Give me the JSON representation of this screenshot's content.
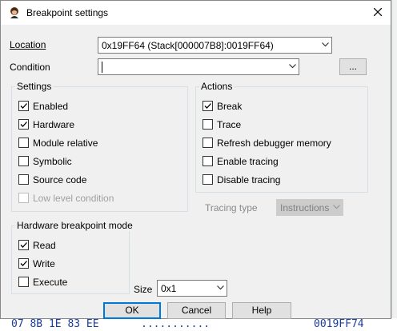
{
  "window": {
    "title": "Breakpoint settings"
  },
  "location": {
    "label": "Location",
    "value": "0x19FF64 (Stack[000007B8]:0019FF64)"
  },
  "condition": {
    "label": "Condition",
    "value": "",
    "browse_label": "..."
  },
  "settings": {
    "title": "Settings",
    "items": [
      {
        "label": "Enabled",
        "checked": true,
        "enabled": true
      },
      {
        "label": "Hardware",
        "checked": true,
        "enabled": true
      },
      {
        "label": "Module relative",
        "checked": false,
        "enabled": true
      },
      {
        "label": "Symbolic",
        "checked": false,
        "enabled": true
      },
      {
        "label": "Source code",
        "checked": false,
        "enabled": true
      },
      {
        "label": "Low level condition",
        "checked": false,
        "enabled": false
      }
    ]
  },
  "actions": {
    "title": "Actions",
    "items": [
      {
        "label": "Break",
        "checked": true,
        "enabled": true
      },
      {
        "label": "Trace",
        "checked": false,
        "enabled": true
      },
      {
        "label": "Refresh debugger memory",
        "checked": false,
        "enabled": true
      },
      {
        "label": "Enable tracing",
        "checked": false,
        "enabled": true
      },
      {
        "label": "Disable tracing",
        "checked": false,
        "enabled": true
      }
    ]
  },
  "tracing": {
    "label": "Tracing type",
    "value": "Instructions",
    "enabled": false
  },
  "hw_mode": {
    "title": "Hardware breakpoint mode",
    "items": [
      {
        "label": "Read",
        "checked": true,
        "enabled": true
      },
      {
        "label": "Write",
        "checked": true,
        "enabled": true
      },
      {
        "label": "Execute",
        "checked": false,
        "enabled": true
      }
    ]
  },
  "size": {
    "label": "Size",
    "value": "0x1"
  },
  "buttons": {
    "ok": "OK",
    "cancel": "Cancel",
    "help": "Help"
  },
  "background": {
    "left_text": "07 8B 1E 83 EE",
    "right_text": "0019FF74"
  },
  "colors": {
    "accent": "#0078d7",
    "bg_text": "#1a3fa0"
  }
}
